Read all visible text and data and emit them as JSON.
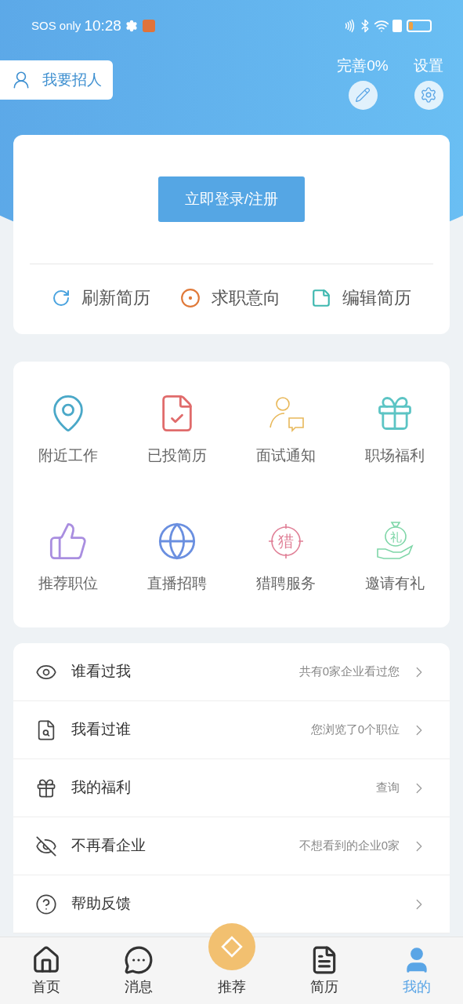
{
  "status_bar": {
    "carrier": "SOS only",
    "time": "10:28"
  },
  "header": {
    "recruit_button": "我要招人",
    "complete": "完善0%",
    "settings": "设置"
  },
  "login_card": {
    "login_button": "立即登录/注册",
    "actions": [
      {
        "kind": "refresh",
        "label": "刷新简历"
      },
      {
        "kind": "intent",
        "label": "求职意向"
      },
      {
        "kind": "edit",
        "label": "编辑简历"
      }
    ]
  },
  "features": [
    {
      "kind": "nearby",
      "label": "附近工作"
    },
    {
      "kind": "applied",
      "label": "已投简历"
    },
    {
      "kind": "interview",
      "label": "面试通知"
    },
    {
      "kind": "gift",
      "label": "职场福利"
    },
    {
      "kind": "recommend",
      "label": "推荐职位"
    },
    {
      "kind": "live",
      "label": "直播招聘"
    },
    {
      "kind": "hunter",
      "label": "猎聘服务",
      "glyph": "猎"
    },
    {
      "kind": "invite",
      "label": "邀请有礼",
      "glyph": "礼"
    }
  ],
  "menu": [
    {
      "kind": "eye",
      "label": "谁看过我",
      "detail": "共有0家企业看过您"
    },
    {
      "kind": "doc",
      "label": "我看过谁",
      "detail": "您浏览了0个职位"
    },
    {
      "kind": "gift",
      "label": "我的福利",
      "detail": "查询"
    },
    {
      "kind": "hidden",
      "label": "不再看企业",
      "detail": "不想看到的企业0家"
    },
    {
      "kind": "help",
      "label": "帮助反馈"
    }
  ],
  "tab_bar": [
    {
      "kind": "home",
      "label": "首页",
      "selected": false
    },
    {
      "kind": "message",
      "label": "消息",
      "selected": false
    },
    {
      "kind": "recommend",
      "label": "推荐",
      "selected": false
    },
    {
      "kind": "resume",
      "label": "简历",
      "selected": false
    },
    {
      "kind": "me",
      "label": "我的",
      "selected": true
    }
  ]
}
